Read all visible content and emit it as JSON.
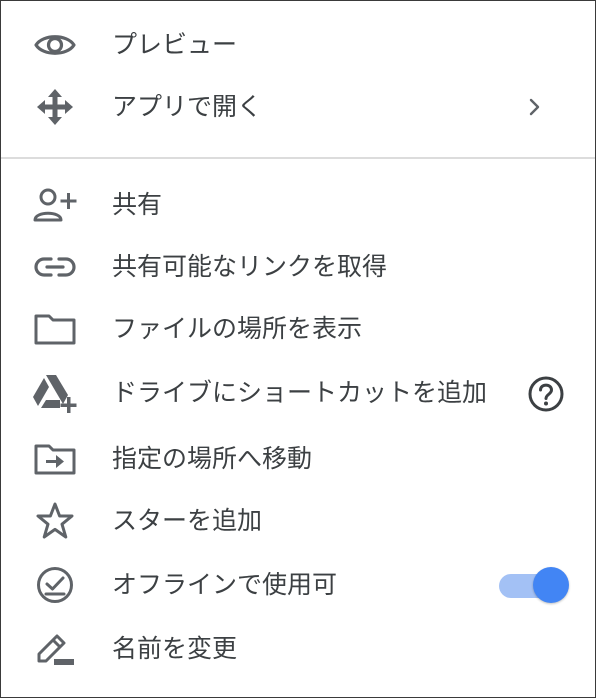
{
  "menu": {
    "items": [
      {
        "label": "プレビュー",
        "icon": "eye-icon"
      },
      {
        "label": "アプリで開く",
        "icon": "open-with-icon"
      },
      {
        "label": "共有",
        "icon": "add-person-icon"
      },
      {
        "label": "共有可能なリンクを取得",
        "icon": "link-icon"
      },
      {
        "label": "ファイルの場所を表示",
        "icon": "folder-icon"
      },
      {
        "label": "ドライブにショートカットを追加",
        "icon": "drive-add-icon"
      },
      {
        "label": "指定の場所へ移動",
        "icon": "move-to-folder-icon"
      },
      {
        "label": "スターを追加",
        "icon": "star-outline-icon"
      },
      {
        "label": "オフラインで使用可",
        "icon": "offline-check-icon"
      },
      {
        "label": "名前を変更",
        "icon": "rename-pen-icon"
      }
    ],
    "offline_toggle": {
      "state": "on"
    }
  },
  "colors": {
    "icon": "#5f6368",
    "text": "#3c4043",
    "toggle_track": "#a3c1f5",
    "toggle_knob": "#4285f4",
    "divider": "#dcdcdc",
    "frame_border": "#3a3a3a"
  }
}
